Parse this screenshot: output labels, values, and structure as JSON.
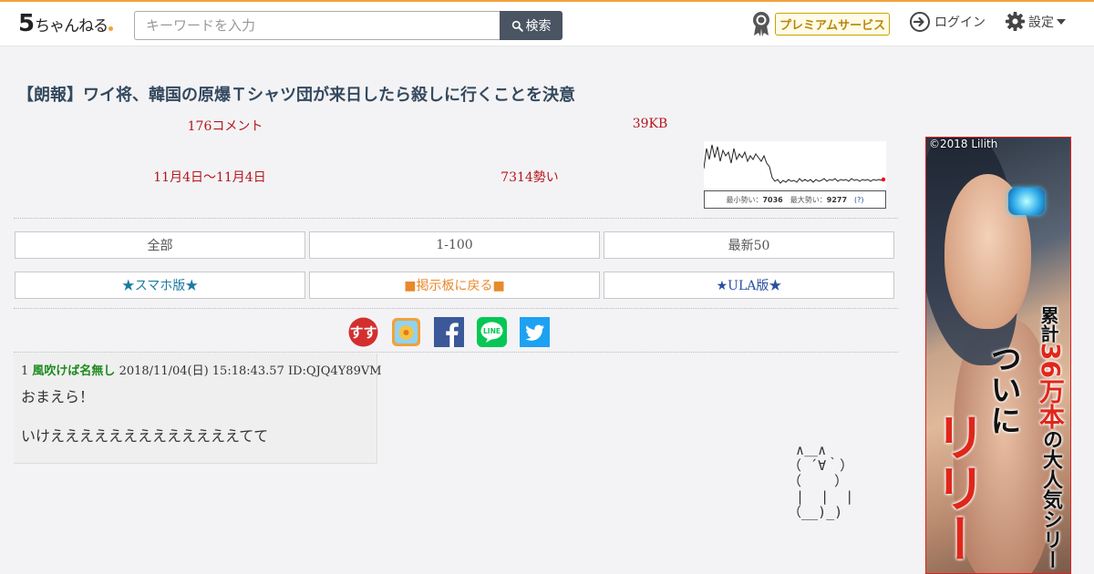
{
  "header": {
    "logo_main": "5",
    "logo_rest": "ちゃんねる",
    "search_placeholder": "キーワードを入力",
    "search_button": "検索",
    "premium_label": "プレミアムサービス",
    "login_label": "ログイン",
    "settings_label": "設定"
  },
  "thread": {
    "title": "【朗報】ワイ将、韓国の原爆Ｔシャツ団が来日したら殺しに行くことを決意",
    "comments": "176コメント",
    "size": "39KB",
    "date_range": "11月4日〜11月4日",
    "momentum": "7314勢い",
    "graph_min_label": "最小勢い：",
    "graph_min_value": "7036",
    "graph_max_label": "最大勢い：",
    "graph_max_value": "9277",
    "graph_help": "(?)"
  },
  "nav": {
    "all": "全部",
    "range": "1-100",
    "latest": "最新50",
    "smartphone": "★スマホ版★",
    "back_to_board": "■掲示板に戻る■",
    "ula": "★ULA版★"
  },
  "share": {
    "colors": {
      "sumaho": "#d32f2f",
      "facebook": "#3b5998",
      "line": "#06c755",
      "twitter": "#1da1f2"
    }
  },
  "post": {
    "number": "1",
    "name": "風吹けば名無し",
    "datetime": "2018/11/04(日) 15:18:43.57",
    "id": "ID:QJQ4Y89VM",
    "lines": [
      "おまえら！",
      "いけえええええええええええええてて"
    ]
  },
  "ascii_art": "  ∧＿∧\n （ ´∀｀）\n （    ）\n  |  |  |\n （__)_)",
  "ad": {
    "copyright": "©2018 Lilith",
    "t1": "累計",
    "t2": "36万本",
    "t3": "の大人気シリー",
    "t4": "ついに",
    "t5": "リリー"
  }
}
